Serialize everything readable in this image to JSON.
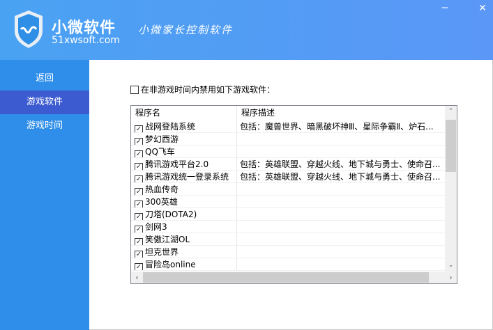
{
  "header": {
    "brand": "小微软件",
    "domain": "51xwsoft.com",
    "slogan": "小微家长控制软件",
    "colors": {
      "start": "#4aa2f3",
      "end": "#5a97f6"
    }
  },
  "window": {
    "minimize_icon": "minimize-icon",
    "close_icon": "close-icon"
  },
  "sidebar": {
    "items": [
      {
        "label": "返回"
      },
      {
        "label": "游戏软件",
        "selected": true
      },
      {
        "label": "游戏时间"
      }
    ]
  },
  "main": {
    "ban_checkbox": {
      "label": "在非游戏时间内禁用如下游戏软件：",
      "checked": false
    },
    "list": {
      "columns": [
        "程序名",
        "程序描述"
      ],
      "rows": [
        {
          "name": "战网登陆系统",
          "desc": "包括：魔兽世界、暗黑破坏神Ⅲ、星际争霸Ⅱ、炉石...",
          "checked": true
        },
        {
          "name": "梦幻西游",
          "desc": "",
          "checked": true
        },
        {
          "name": "QQ飞车",
          "desc": "",
          "checked": true
        },
        {
          "name": "腾讯游戏平台2.0",
          "desc": "包括：英雄联盟、穿越火线、地下城与勇士、使命召...",
          "checked": true
        },
        {
          "name": "腾讯游戏统一登录系统",
          "desc": "包括：英雄联盟、穿越火线、地下城与勇士、使命召...",
          "checked": true
        },
        {
          "name": "热血传奇",
          "desc": "",
          "checked": true
        },
        {
          "name": "300英雄",
          "desc": "",
          "checked": true
        },
        {
          "name": "刀塔(DOTA2)",
          "desc": "",
          "checked": true
        },
        {
          "name": "剑网3",
          "desc": "",
          "checked": true
        },
        {
          "name": "笑傲江湖OL",
          "desc": "",
          "checked": true
        },
        {
          "name": "坦克世界",
          "desc": "",
          "checked": true
        },
        {
          "name": "冒险岛online",
          "desc": "",
          "checked": true
        }
      ]
    }
  }
}
